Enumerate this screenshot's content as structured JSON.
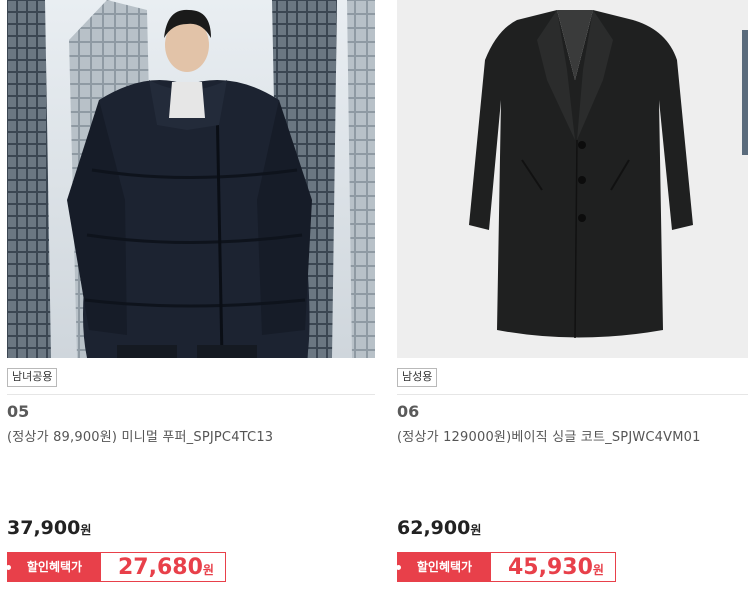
{
  "products": [
    {
      "image_alt": "navy-puffer-model-photo",
      "tag": "남녀공용",
      "number": "05",
      "name": "(정상가 89,900원) 미니멀 푸퍼_SPJPC4TC13",
      "price": "37,900",
      "price_unit": "원",
      "sale_label": "할인혜택가",
      "sale_price": "27,680",
      "sale_unit": "원"
    },
    {
      "image_alt": "black-single-coat-photo",
      "tag": "남성용",
      "number": "06",
      "name": "(정상가 129000원)베이직 싱글 코트_SPJWC4VM01",
      "price": "62,900",
      "price_unit": "원",
      "sale_label": "할인혜택가",
      "sale_price": "45,930",
      "sale_unit": "원"
    }
  ],
  "colors": {
    "accent": "#e8404a",
    "tag_border": "#b9b9b9"
  }
}
